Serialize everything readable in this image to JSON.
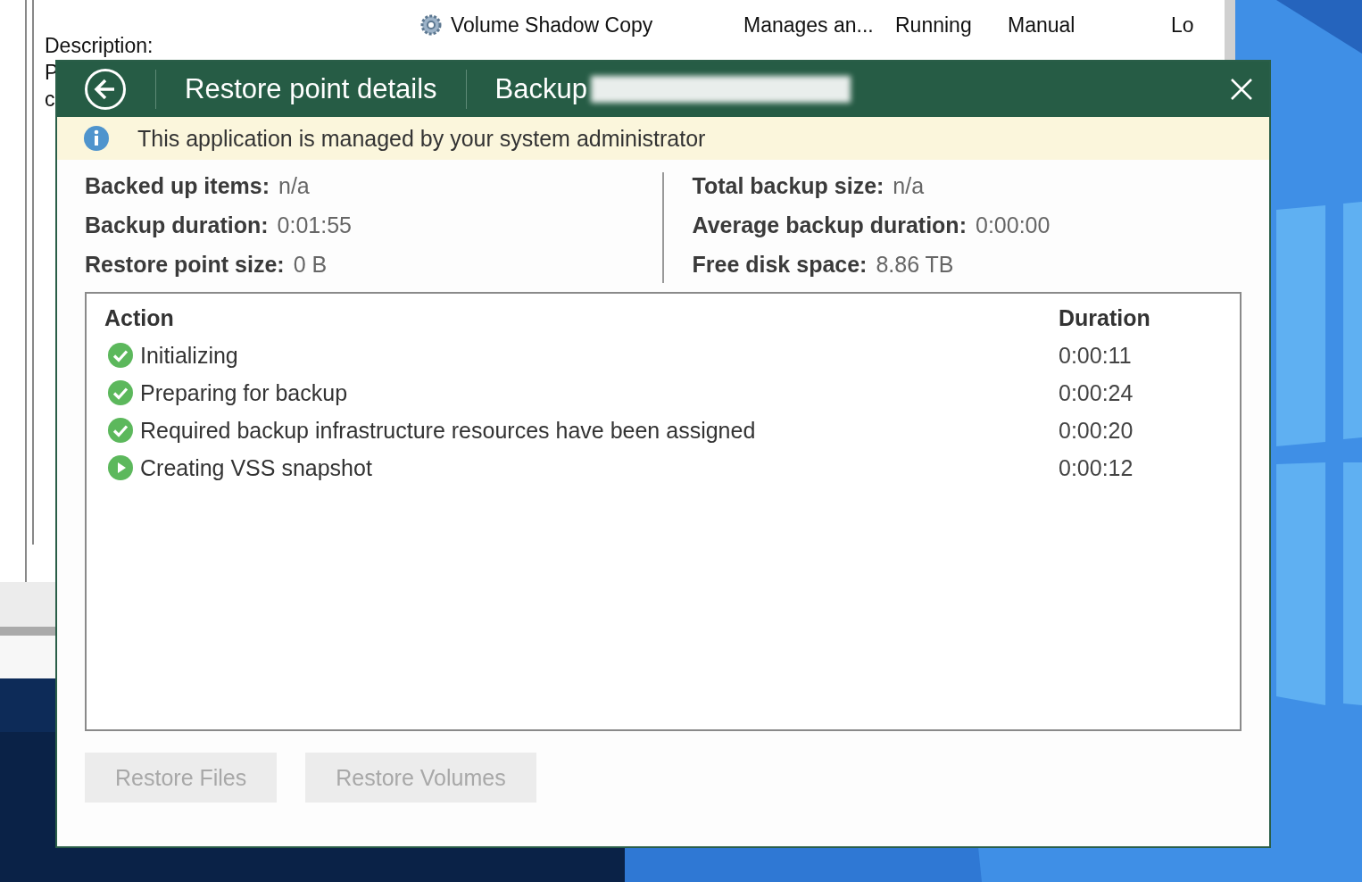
{
  "services_window": {
    "description_label": "Description:",
    "cut_letters": [
      "P",
      "c"
    ],
    "rows": [
      {
        "name": "Volume Shadow Copy",
        "description": "Manages an...",
        "status": "Running",
        "startup_type": "Manual",
        "log_on_as": "Lo"
      }
    ]
  },
  "dialog": {
    "title": "Restore point details",
    "subtitle": "Backup",
    "notice": "This application is managed by your system administrator",
    "stats_left": [
      {
        "label": "Backed up items:",
        "value": "n/a"
      },
      {
        "label": "Backup duration:",
        "value": "0:01:55"
      },
      {
        "label": "Restore point size:",
        "value": "0 B"
      }
    ],
    "stats_right": [
      {
        "label": "Total backup size:",
        "value": "n/a"
      },
      {
        "label": "Average backup duration:",
        "value": "0:00:00"
      },
      {
        "label": "Free disk space:",
        "value": "8.86 TB"
      }
    ],
    "table": {
      "columns": [
        "Action",
        "Duration"
      ],
      "rows": [
        {
          "kind": "success",
          "action": "Initializing",
          "duration": "0:00:11"
        },
        {
          "kind": "success",
          "action": "Preparing for backup",
          "duration": "0:00:24"
        },
        {
          "kind": "success",
          "action": "Required backup infrastructure resources have been assigned",
          "duration": "0:00:20"
        },
        {
          "kind": "running",
          "action": "Creating VSS snapshot",
          "duration": "0:00:12"
        }
      ]
    },
    "buttons": [
      {
        "label": "Restore Files",
        "disabled": true
      },
      {
        "label": "Restore Volumes",
        "disabled": true
      }
    ]
  }
}
